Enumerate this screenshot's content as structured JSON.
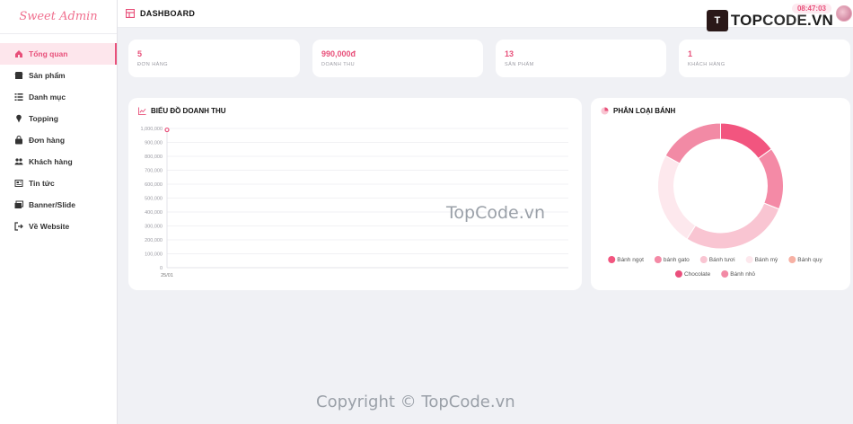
{
  "app": {
    "brand": "Sweet Admin"
  },
  "sidebar": {
    "items": [
      {
        "label": "Tổng quan",
        "icon": "home-icon",
        "active": true
      },
      {
        "label": "Sản phẩm",
        "icon": "store-icon"
      },
      {
        "label": "Danh mục",
        "icon": "list-icon"
      },
      {
        "label": "Topping",
        "icon": "ice-cream-icon"
      },
      {
        "label": "Đơn hàng",
        "icon": "shopping-bag-icon"
      },
      {
        "label": "Khách hàng",
        "icon": "users-icon"
      },
      {
        "label": "Tin tức",
        "icon": "newspaper-icon"
      },
      {
        "label": "Banner/Slide",
        "icon": "images-icon"
      },
      {
        "label": "Về Website",
        "icon": "sign-out-icon"
      }
    ]
  },
  "header": {
    "title": "DASHBOARD",
    "clock": "08:47:03"
  },
  "logo": {
    "mark": "T",
    "text_top": "TOP",
    "text_code": "CODE",
    "text_tld": ".VN"
  },
  "stats": [
    {
      "value": "5",
      "label": "Đơn hàng"
    },
    {
      "value": "990,000đ",
      "label": "Doanh thu"
    },
    {
      "value": "13",
      "label": "Sản phẩm"
    },
    {
      "value": "1",
      "label": "Khách hàng"
    }
  ],
  "revenue_panel": {
    "title": "BIỂU ĐỒ DOANH THU"
  },
  "category_panel": {
    "title": "PHÂN LOẠI BÁNH"
  },
  "watermarks": {
    "center": "TopCode.vn",
    "footer": "Copyright © TopCode.vn"
  },
  "colors": {
    "accent": "#e8507a",
    "brand": "#f0708f"
  },
  "chart_data": [
    {
      "type": "line",
      "title": "BIỂU ĐỒ DOANH THU",
      "categories": [
        "25/01"
      ],
      "series": [
        {
          "values": [
            990000
          ]
        }
      ],
      "ylim": [
        0,
        1000000
      ],
      "yticks": [
        "1,000,000",
        "900,000",
        "800,000",
        "700,000",
        "600,000",
        "500,000",
        "400,000",
        "300,000",
        "200,000",
        "100,000",
        "0"
      ],
      "grid": true
    },
    {
      "type": "pie",
      "title": "PHÂN LOẠI BÁNH",
      "legend_position": "bottom",
      "categories": [
        "Bánh ngọt",
        "bánh gato",
        "Bánh tươi",
        "Bánh mỳ",
        "Bánh quy",
        "Chocolate",
        "Bánh nhỏ"
      ],
      "values": [
        15,
        16,
        28,
        24,
        0,
        0,
        17
      ],
      "colors": [
        "#f2557f",
        "#f48aa6",
        "#f9c5d2",
        "#fde8ed",
        "#f7b1a4",
        "#ea4f7c",
        "#f28aa5"
      ]
    }
  ]
}
